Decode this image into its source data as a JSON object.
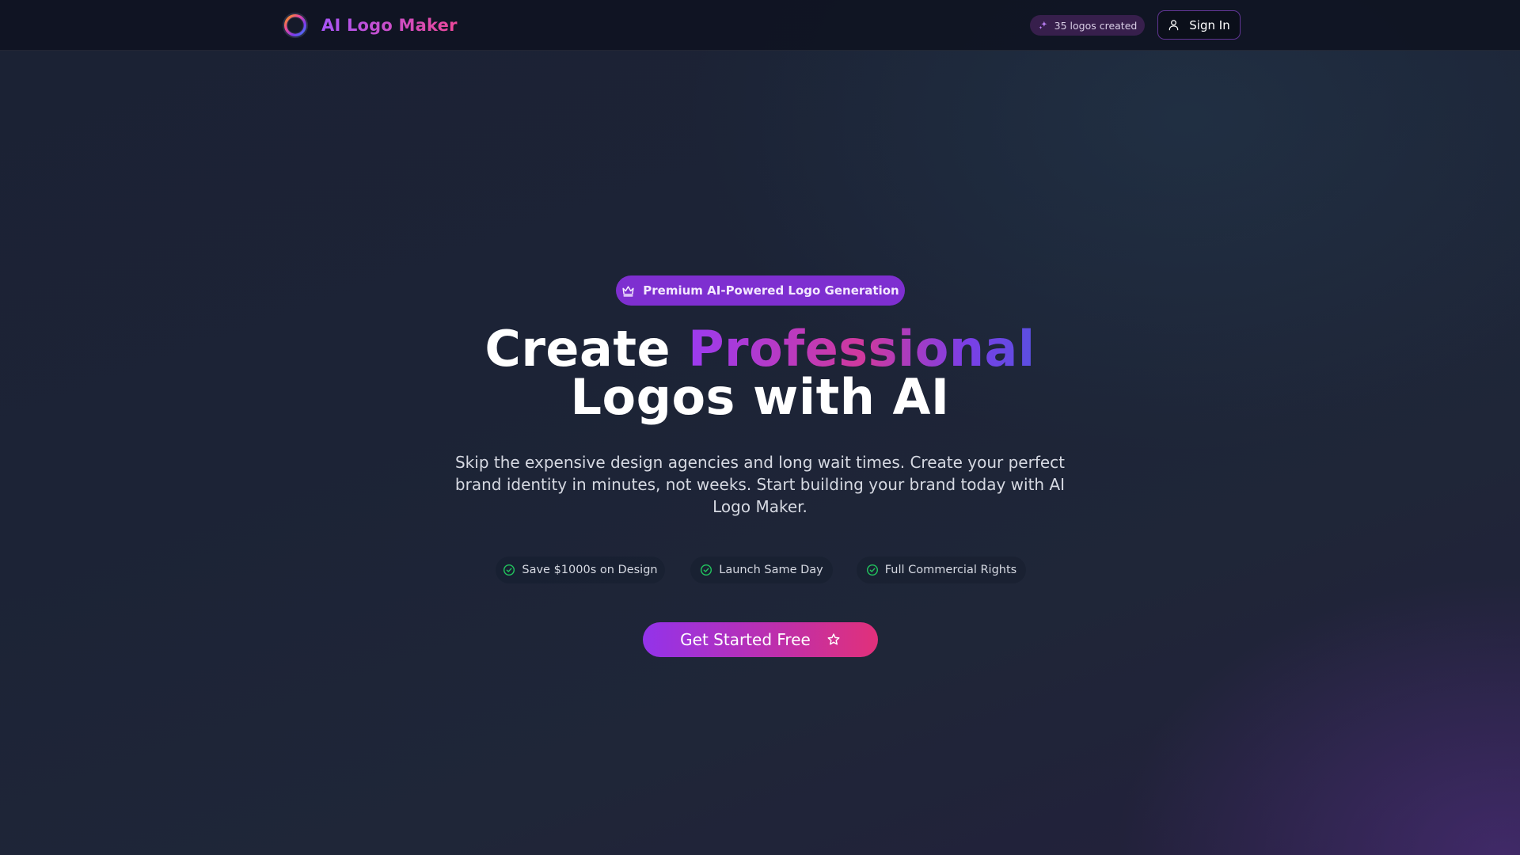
{
  "header": {
    "brand_name": "AI Logo Maker",
    "stat_text": "35 logos created",
    "signin_label": "Sign In"
  },
  "hero": {
    "badge": "Premium AI-Powered Logo Generation",
    "headline_prefix": "Create ",
    "headline_highlight": "Professional",
    "headline_line2": "Logos with AI",
    "subtitle": "Skip the expensive design agencies and long wait times. Create your perfect brand identity in minutes, not weeks. Start building your brand today with AI Logo Maker.",
    "features": [
      {
        "label": "Save $1000s on Design",
        "icon": "check-circle-icon"
      },
      {
        "label": "Launch Same Day",
        "icon": "check-circle-icon"
      },
      {
        "label": "Full Commercial Rights",
        "icon": "check-circle-icon"
      }
    ],
    "cta_label": "Get Started Free"
  },
  "colors": {
    "accent_purple": "#9333ea",
    "accent_pink": "#ec4899",
    "check_green": "#22c55e",
    "header_bg": "#0f1422"
  }
}
